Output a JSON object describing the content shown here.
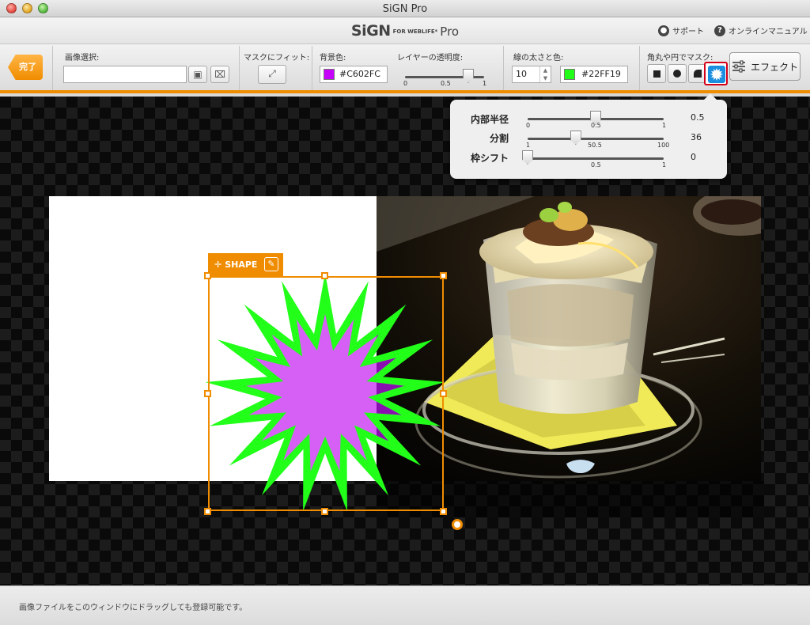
{
  "window": {
    "title": "SiGN Pro"
  },
  "header": {
    "logo_main": "SiGN",
    "logo_for": "FOR WEBLIFE*",
    "logo_pro": "Pro",
    "support_label": "サポート",
    "manual_label": "オンラインマニュアル"
  },
  "toolbar": {
    "done_label": "完了",
    "image_select_label": "画像選択:",
    "image_path_value": "",
    "fit_mask_label": "マスクにフィット:",
    "bg_color_label": "背景色:",
    "bg_color_value": "#C602FC",
    "bg_color_hex": "#C602FC",
    "opacity_label": "レイヤーの透明度:",
    "opacity": {
      "min": "0",
      "mid": "0.5",
      "max": "1",
      "value": 0.8
    },
    "stroke_label": "線の太さと色:",
    "stroke_width_value": "10",
    "stroke_color_value": "#22FF19",
    "stroke_color_hex": "#22FF19",
    "mask_label": "角丸や円でマスク:",
    "mask_options": [
      "square-icon",
      "circle-icon",
      "rounded-corner-icon",
      "starburst-icon"
    ],
    "mask_selected": "starburst-icon",
    "effect_label": "エフェクト"
  },
  "popover": {
    "rows": [
      {
        "label": "内部半径",
        "min": "0",
        "mid": "0.5",
        "max": "1",
        "value_text": "0.5",
        "value": 0.5
      },
      {
        "label": "分割",
        "min": "1",
        "mid": "50.5",
        "max": "100",
        "value_text": "36",
        "value": 36
      },
      {
        "label": "枠シフト",
        "min": "",
        "mid": "0.5",
        "max": "1",
        "value_text": "0",
        "value": 0
      }
    ]
  },
  "canvas": {
    "shape_tag_label": "SHAPE",
    "fill_color": "#D65FF5",
    "stroke_color": "#22FF19",
    "accent_color": "#F08C00",
    "shape_spikes": 17,
    "shape_inner_radius_ratio": 0.5
  },
  "status": {
    "text": "画像ファイルをこのウィンドウにドラッグしても登録可能です。"
  }
}
